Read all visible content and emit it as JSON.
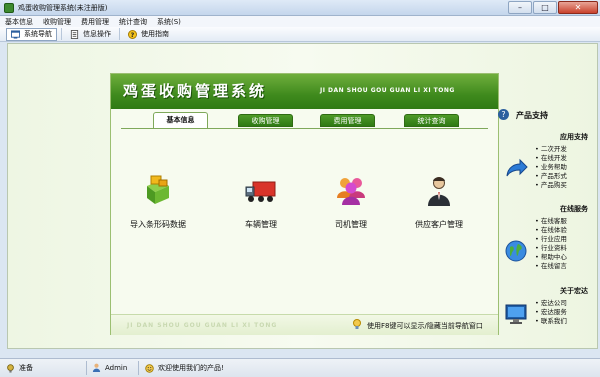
{
  "window": {
    "title": "鸡蛋收购管理系统(未注册版)",
    "minimize": "–",
    "maximize": "□",
    "close": "✕"
  },
  "menu": [
    "基本信息",
    "收购管理",
    "费用管理",
    "统计查询",
    "系统(S)"
  ],
  "toolbar": [
    {
      "label": "系统导航",
      "icon": "navigation-icon"
    },
    {
      "label": "信息操作",
      "icon": "document-icon"
    },
    {
      "label": "使用指南",
      "icon": "help-icon"
    }
  ],
  "panel": {
    "title": "鸡蛋收购管理系统",
    "pinyin": "JI DAN SHOU GOU GUAN LI XI TONG",
    "tabs": [
      {
        "label": "基本信息",
        "active": true
      },
      {
        "label": "收购管理",
        "active": false
      },
      {
        "label": "费用管理",
        "active": false
      },
      {
        "label": "统计查询",
        "active": false
      }
    ],
    "tiles": [
      {
        "label": "导入条形码数据",
        "icon": "import-barcode-icon"
      },
      {
        "label": "车辆管理",
        "icon": "truck-icon"
      },
      {
        "label": "司机管理",
        "icon": "drivers-icon"
      },
      {
        "label": "供应客户管理",
        "icon": "supplier-icon"
      }
    ],
    "footer_pinyin": "JI DAN SHOU GOU GUAN LI XI TONG",
    "footer_hint": "使用F8键可以显示/隐藏当前导航窗口"
  },
  "sidebar": {
    "title": "产品支持",
    "groups": [
      {
        "heading": "应用支持",
        "icon": "arrow-icon",
        "items": [
          "二次开发",
          "在线开发",
          "业务帮助",
          "产品形式",
          "产品购买"
        ]
      },
      {
        "heading": "在线服务",
        "icon": "globe-icon",
        "items": [
          "在线客服",
          "在线体验",
          "行业应用",
          "行业资料",
          "帮助中心",
          "在线留言"
        ]
      },
      {
        "heading": "关于宏达",
        "icon": "monitor-icon",
        "items": [
          "宏达公司",
          "宏达服务",
          "联系我们"
        ]
      }
    ]
  },
  "status": {
    "state": "准备",
    "user": "Admin",
    "message": "欢迎使用我们的产品!"
  },
  "colors": {
    "header_green": "#3f8a1d",
    "tab_green": "#2f7a14",
    "window_blue": "#dbe6f2"
  }
}
